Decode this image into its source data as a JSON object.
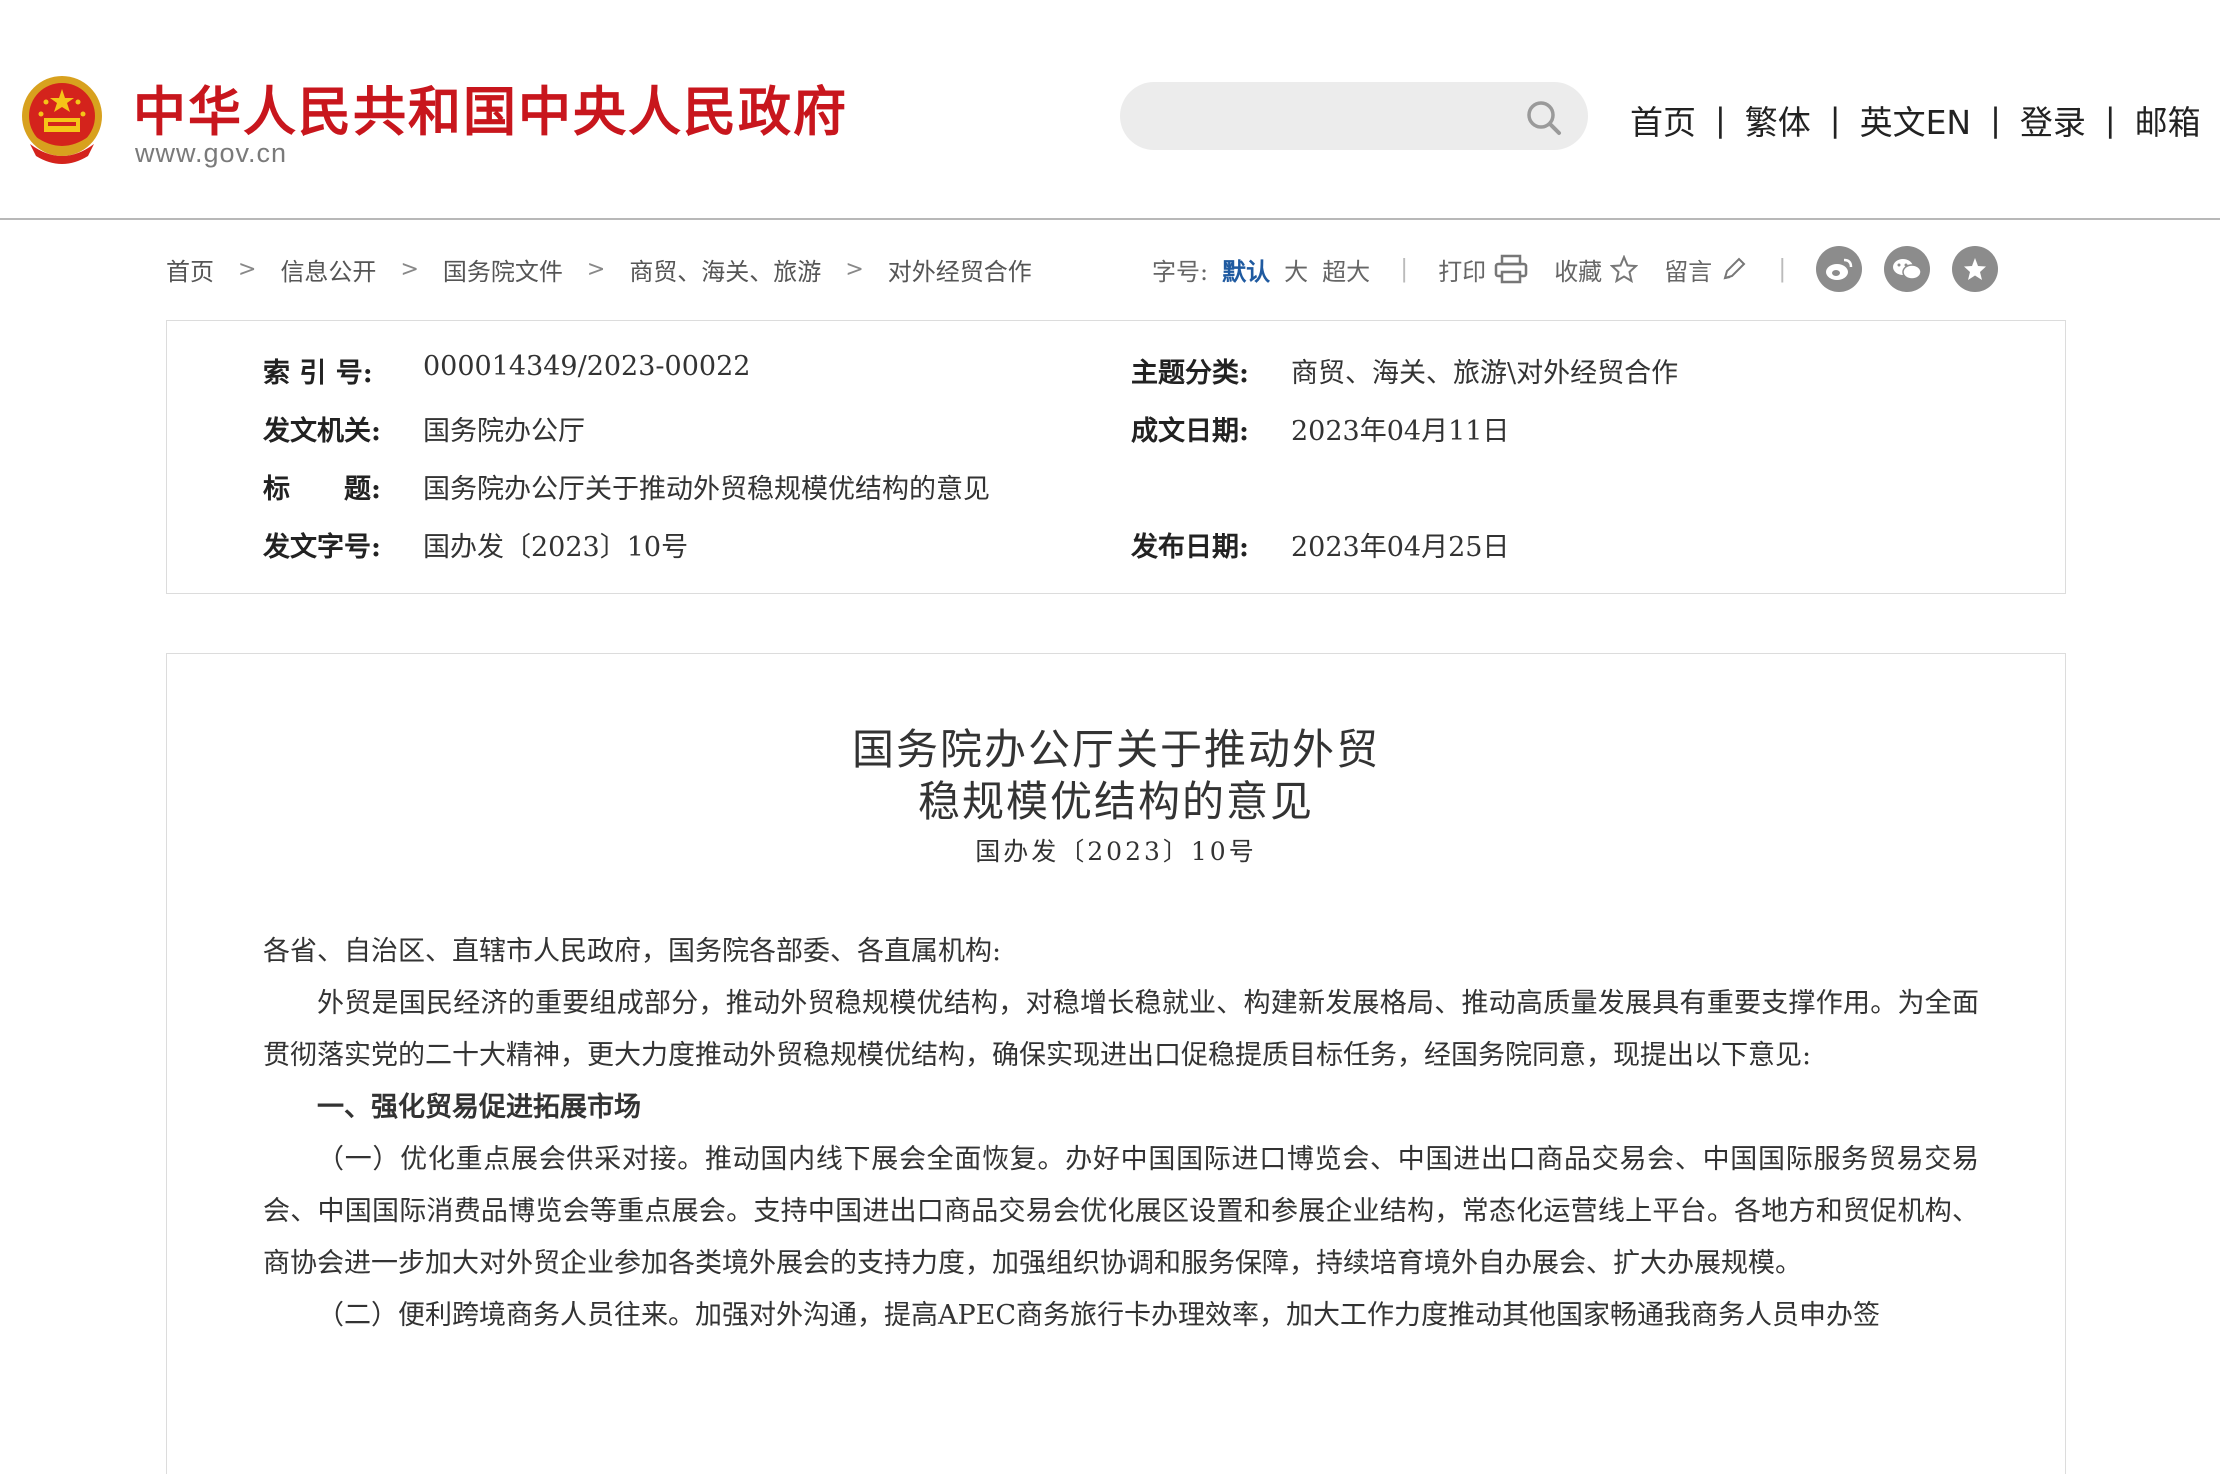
{
  "header": {
    "site_title": "中华人民共和国中央人民政府",
    "site_url": "www.gov.cn",
    "search": {
      "placeholder": ""
    },
    "nav": [
      "首页",
      "繁体",
      "英文EN",
      "登录",
      "邮箱"
    ],
    "nav_separator": "|"
  },
  "breadcrumb": {
    "items": [
      "首页",
      "信息公开",
      "国务院文件",
      "商贸、海关、旅游",
      "对外经贸合作"
    ],
    "arrow": ">"
  },
  "tools": {
    "font_size_label": "字号:",
    "font_sizes": [
      "默认",
      "大",
      "超大"
    ],
    "active_font_size": "默认",
    "print": "打印",
    "favorite": "收藏",
    "comment": "留言",
    "separator": "|",
    "share_icons": [
      "weibo-icon",
      "wechat-icon",
      "star-icon"
    ]
  },
  "metadata": {
    "index_label": "索 引 号:",
    "index_value": "000014349/2023-00022",
    "topic_label": "主题分类:",
    "topic_value": "商贸、海关、旅游\\对外经贸合作",
    "issuer_label": "发文机关:",
    "issuer_value": "国务院办公厅",
    "date_written_label": "成文日期:",
    "date_written_value": "2023年04月11日",
    "title_label": "标　　题:",
    "title_value": "国务院办公厅关于推动外贸稳规模优结构的意见",
    "doc_no_label": "发文字号:",
    "doc_no_value": "国办发〔2023〕10号",
    "publish_date_label": "发布日期:",
    "publish_date_value": "2023年04月25日"
  },
  "article": {
    "title_line1": "国务院办公厅关于推动外贸",
    "title_line2": "稳规模优结构的意见",
    "doc_number": "国办发〔2023〕10号",
    "salutation": "各省、自治区、直辖市人民政府，国务院各部委、各直属机构:",
    "para1": "外贸是国民经济的重要组成部分，推动外贸稳规模优结构，对稳增长稳就业、构建新发展格局、推动高质量发展具有重要支撑作用。为全面贯彻落实党的二十大精神，更大力度推动外贸稳规模优结构，确保实现进出口促稳提质目标任务，经国务院同意，现提出以下意见:",
    "section1_heading": "一、强化贸易促进拓展市场",
    "para2": "（一）优化重点展会供采对接。推动国内线下展会全面恢复。办好中国国际进口博览会、中国进出口商品交易会、中国国际服务贸易交易会、中国国际消费品博览会等重点展会。支持中国进出口商品交易会优化展区设置和参展企业结构，常态化运营线上平台。各地方和贸促机构、商协会进一步加大对外贸企业参加各类境外展会的支持力度，加强组织协调和服务保障，持续培育境外自办展会、扩大办展规模。",
    "para3": "（二）便利跨境商务人员往来。加强对外沟通，提高APEC商务旅行卡办理效率，加大工作力度推动其他国家畅通我商务人员申办签"
  }
}
